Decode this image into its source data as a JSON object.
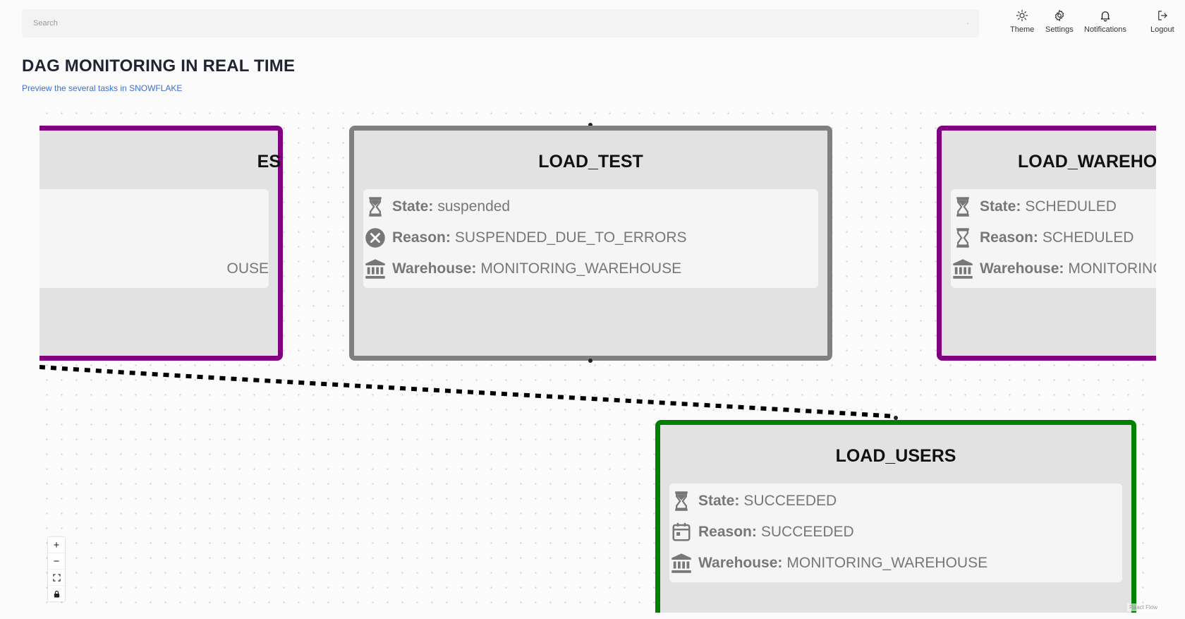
{
  "header": {
    "search_placeholder": "Search",
    "theme_label": "Theme",
    "settings_label": "Settings",
    "notifications_label": "Notifications",
    "logout_label": "Logout"
  },
  "page": {
    "title": "DAG MONITORING IN REAL TIME",
    "subtitle": "Preview the several tasks in SNOWFLAKE"
  },
  "labels": {
    "state": "State:",
    "reason": "Reason:",
    "warehouse": "Warehouse:"
  },
  "nodes": [
    {
      "title": "LOAD_WAREHOUSES",
      "visible_title": "ES",
      "visible_warehouse": "OUSE",
      "status_color": "#800080"
    },
    {
      "title": "LOAD_TEST",
      "state": "suspended",
      "reason": "SUSPENDED_DUE_TO_ERRORS",
      "warehouse": "MONITORING_WAREHOUSE",
      "status_color": "#808080",
      "state_icon": "hourglass-icon",
      "reason_icon": "x-circle-icon",
      "warehouse_icon": "bank-icon"
    },
    {
      "title": "LOAD_WAREHOU",
      "state": "SCHEDULED",
      "reason": "SCHEDULED",
      "warehouse": "MONITORING_",
      "status_color": "#800080",
      "state_icon": "hourglass-icon",
      "reason_icon": "hourglass-outline-icon",
      "warehouse_icon": "bank-icon"
    },
    {
      "title": "LOAD_USERS",
      "state": "SUCCEEDED",
      "reason": "SUCCEEDED",
      "warehouse": "MONITORING_WAREHOUSE",
      "status_color": "#008000",
      "state_icon": "hourglass-icon",
      "reason_icon": "calendar-icon",
      "warehouse_icon": "bank-icon"
    }
  ],
  "controls": {
    "zoom_in": "+",
    "zoom_out": "−"
  },
  "attribution": "React Flow"
}
